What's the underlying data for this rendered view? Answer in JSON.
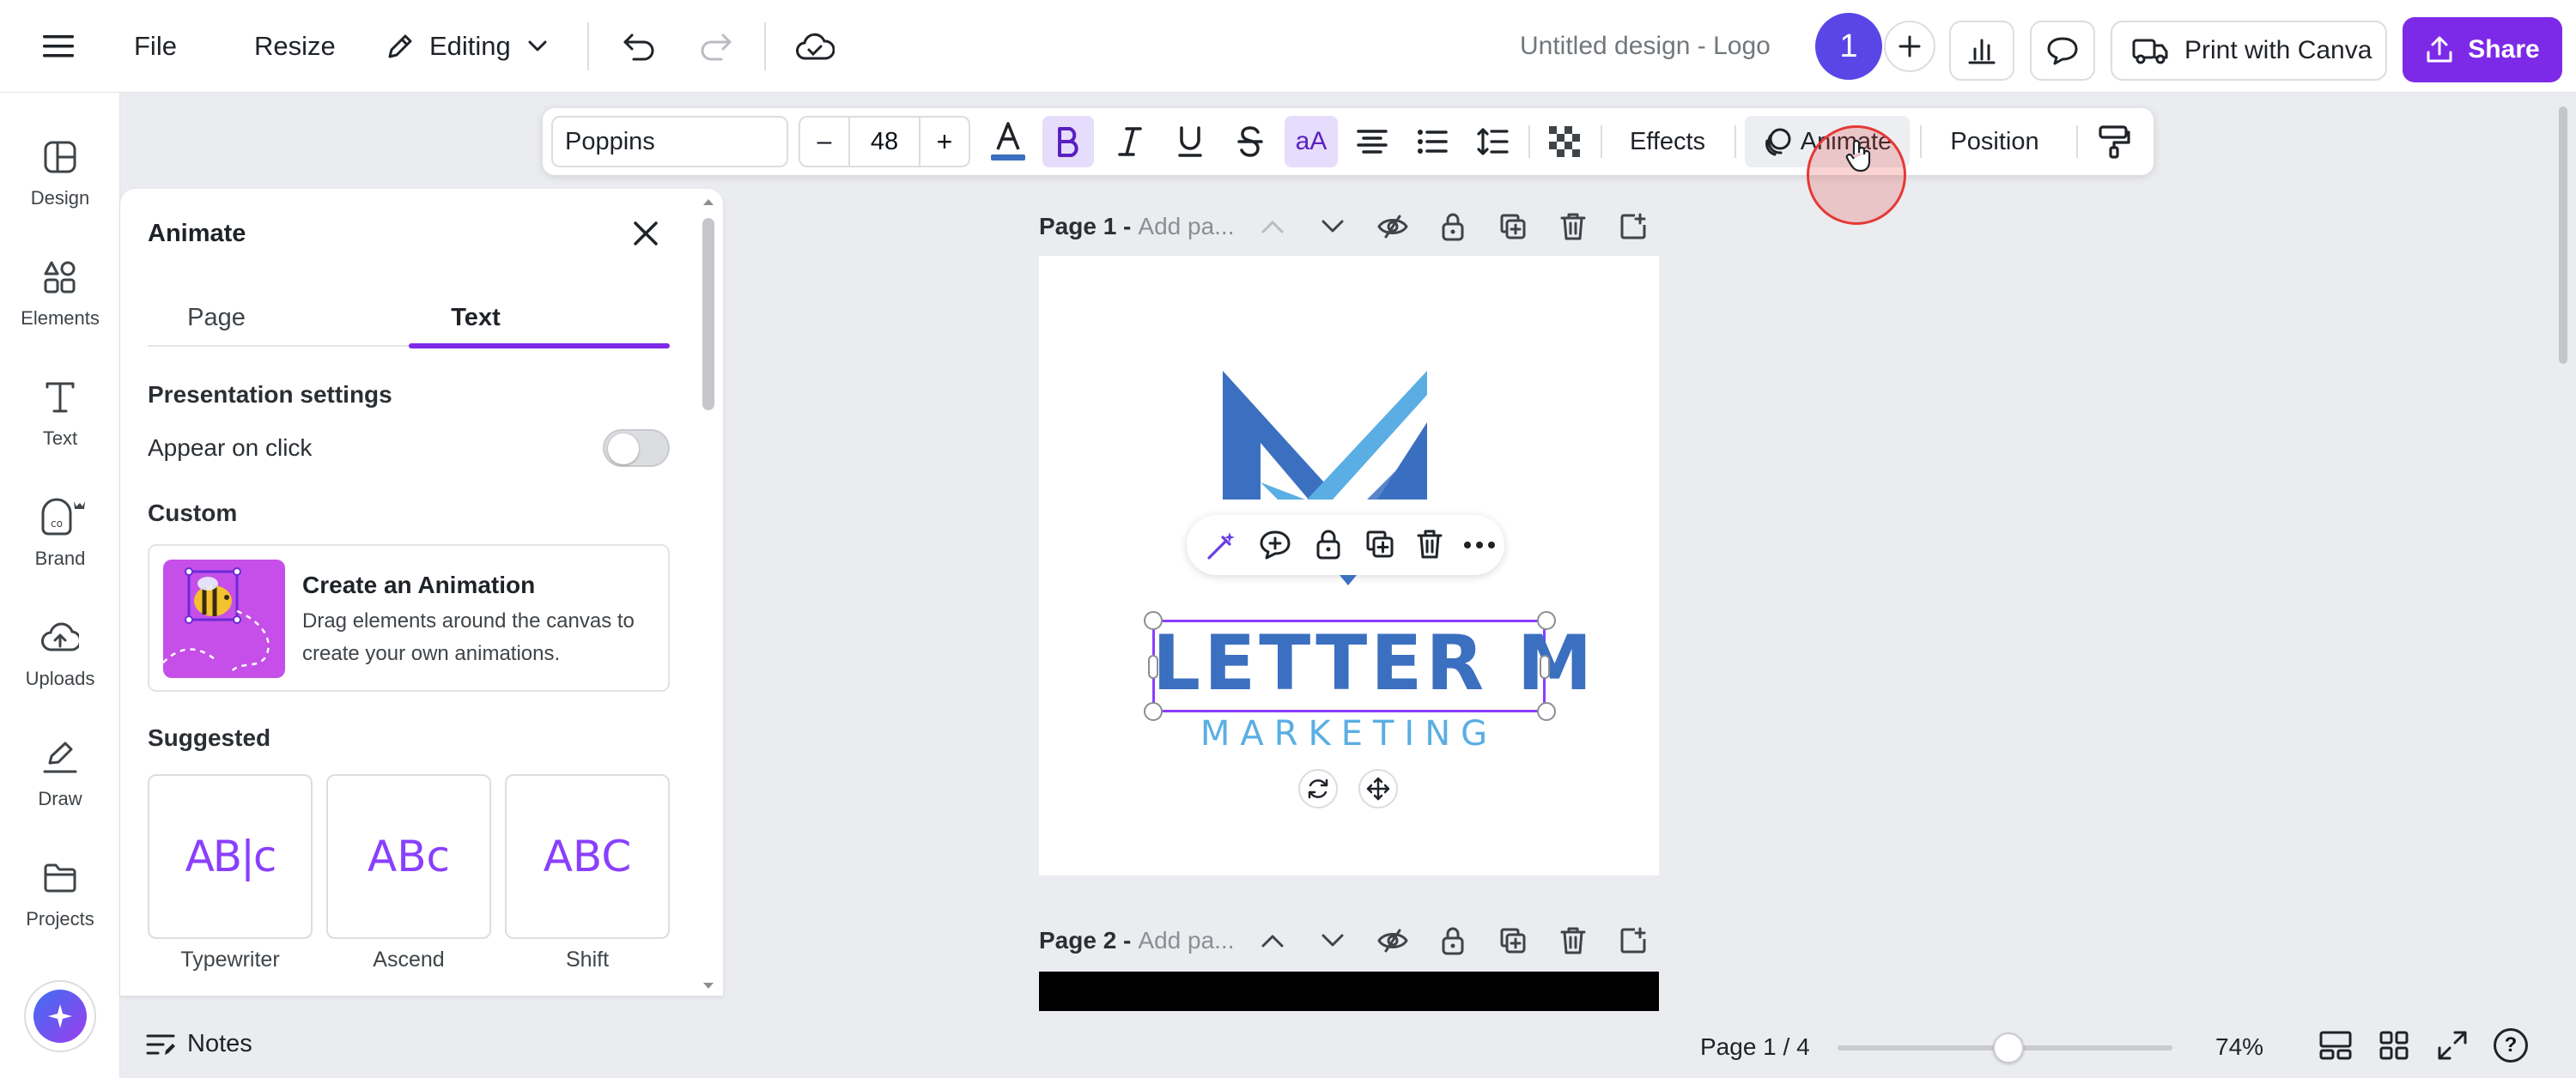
{
  "topbar": {
    "file": "File",
    "resize": "Resize",
    "mode": "Editing",
    "title": "Untitled design - Logo",
    "collaborators_count": "1",
    "print_label": "Print with Canva",
    "share_label": "Share",
    "accent": "#7d2ae8"
  },
  "rail": {
    "items": [
      {
        "label": "Design",
        "icon": "design-icon"
      },
      {
        "label": "Elements",
        "icon": "elements-icon"
      },
      {
        "label": "Text",
        "icon": "text-icon"
      },
      {
        "label": "Brand",
        "icon": "brand-icon"
      },
      {
        "label": "Uploads",
        "icon": "uploads-icon"
      },
      {
        "label": "Draw",
        "icon": "draw-icon"
      },
      {
        "label": "Projects",
        "icon": "projects-icon"
      }
    ]
  },
  "panel": {
    "title": "Animate",
    "tabs": [
      "Page",
      "Text"
    ],
    "active_tab": "Text",
    "presentation_heading": "Presentation settings",
    "appear_on_click": "Appear on click",
    "custom_heading": "Custom",
    "create_title": "Create an Animation",
    "create_desc_1": "Drag elements around the canvas to",
    "create_desc_2": "create your own animations.",
    "suggested_heading": "Suggested",
    "suggested": [
      {
        "label": "Typewriter",
        "sample": "AB|c"
      },
      {
        "label": "Ascend",
        "sample": "ABc"
      },
      {
        "label": "Shift",
        "sample": "ABC"
      }
    ]
  },
  "toolbar": {
    "font": "Poppins",
    "minus": "–",
    "font_size": "48",
    "plus": "+",
    "case_label": "aA",
    "effects": "Effects",
    "animate": "Animate",
    "position": "Position"
  },
  "pages": [
    {
      "label": "Page 1 -",
      "placeholder": "Add pa..."
    },
    {
      "label": "Page 2 -",
      "placeholder": "Add pa..."
    }
  ],
  "canvas": {
    "headline": "LETTER M",
    "subline": "MARKETING",
    "logo_dark": "#3b6fc0",
    "logo_light": "#5aaee3"
  },
  "bottombar": {
    "notes": "Notes",
    "page_indicator": "Page 1 / 4",
    "zoom": "74%",
    "zoom_fraction": 0.51
  }
}
